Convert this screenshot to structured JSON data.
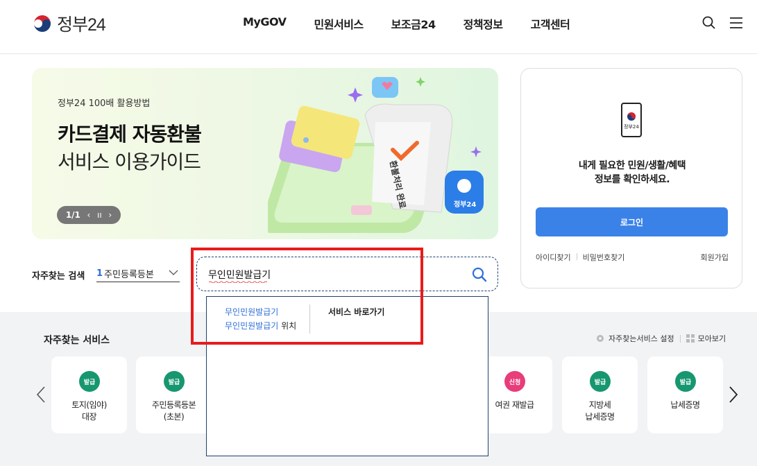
{
  "header": {
    "logo_text": "정부24",
    "nav": [
      "MyGOV",
      "민원서비스",
      "보조금24",
      "정책정보",
      "고객센터"
    ],
    "icons": [
      "search-icon",
      "menu-icon"
    ]
  },
  "banner": {
    "subtitle": "정부24 100배 활용방법",
    "title_bold": "카드결제 자동환불",
    "title_light": "서비스 이용가이드",
    "pager": {
      "current": "1/1",
      "prev": "‹",
      "pause": "ıı",
      "next": "›"
    },
    "illustration_text": [
      "환불처리 완료",
      "정부24"
    ]
  },
  "login": {
    "phone_label": "정부24",
    "message_line1": "내게 필요한 민원/생활/혜택",
    "message_line2": "정보를 확인하세요.",
    "button": "로그인",
    "links": [
      "아이디찾기",
      "비밀번호찾기"
    ],
    "join": "회원가입"
  },
  "frequent_search": {
    "label": "자주찾는 검색",
    "selected_num": "1",
    "selected_text": "주민등록등본"
  },
  "search": {
    "value": "무인민원발급기",
    "suggestions": [
      {
        "highlight": "무인민원발급기",
        "rest": ""
      },
      {
        "highlight": "무인민원발급기",
        "rest": " 위치"
      }
    ],
    "goto_label": "서비스 바로가기"
  },
  "services": {
    "title": "자주찾는 서비스",
    "settings_label": "자주찾는서비스 설정",
    "collect_label": "모아보기",
    "cards": [
      {
        "badge": "발급",
        "badge_color": "#17976f",
        "line1": "토지(임야)",
        "line2": "대장"
      },
      {
        "badge": "발급",
        "badge_color": "#17976f",
        "line1": "주민등록등본",
        "line2": "(초본)"
      },
      {
        "badge": "신청",
        "badge_color": "#e83c7b",
        "line1": "여권 재발급",
        "line2": ""
      },
      {
        "badge": "발급",
        "badge_color": "#17976f",
        "line1": "지방세",
        "line2": "납세증명"
      },
      {
        "badge": "발급",
        "badge_color": "#17976f",
        "line1": "납세증명",
        "line2": ""
      }
    ]
  }
}
